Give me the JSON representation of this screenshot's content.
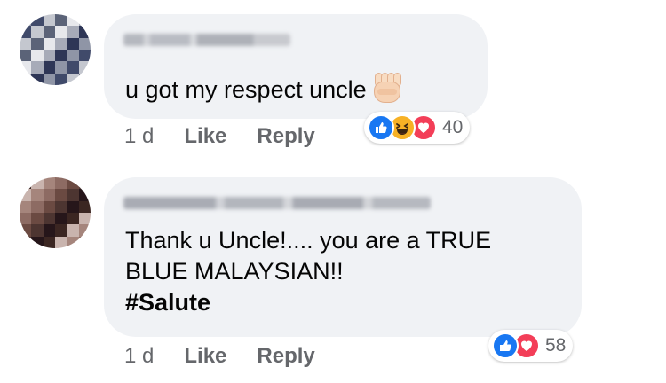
{
  "comments": [
    {
      "text_lines": [
        "u got my respect uncle"
      ],
      "emoji": "raised-fist-light-skin",
      "time": "1 d",
      "like_label": "Like",
      "reply_label": "Reply",
      "reactions": [
        "like-icon",
        "haha-icon",
        "love-icon"
      ],
      "reaction_count": "40",
      "avatar_palette": [
        "#8f95a6",
        "#5b6378",
        "#2e3656",
        "#c4c7cf",
        "#a7abb8",
        "#404a6a",
        "#e7e8ec"
      ]
    },
    {
      "text_lines": [
        "Thank u Uncle!.... you are  a TRUE",
        "BLUE MALAYSIAN!!"
      ],
      "hashtag": "#Salute",
      "time": "1 d",
      "like_label": "Like",
      "reply_label": "Reply",
      "reactions": [
        "like-icon",
        "love-icon"
      ],
      "reaction_count": "58",
      "avatar_palette": [
        "#6b4a42",
        "#3b2622",
        "#8d6b63",
        "#26161a",
        "#a5857c",
        "#4d3531",
        "#c9b4ae"
      ]
    }
  ],
  "colors": {
    "bubble": "#f0f2f5",
    "meta_text": "#65676b",
    "like_blue": "#1877f2",
    "love_red": "#f33e58",
    "haha_yellow": "#f7b125"
  }
}
